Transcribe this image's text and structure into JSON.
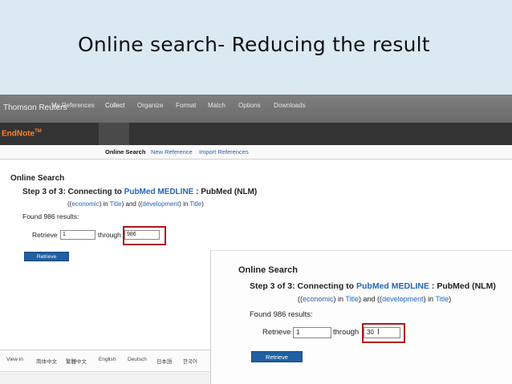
{
  "slide": {
    "title": "Online search- Reducing the result"
  },
  "header": {
    "brand": "Thomson Reuters"
  },
  "nav": {
    "logo": "EndNote",
    "logo_tm": "TM",
    "items": [
      "My References",
      "Collect",
      "Organize",
      "Format",
      "Match",
      "Options",
      "Downloads"
    ],
    "active": "Collect"
  },
  "subnav": {
    "items": [
      "Online Search",
      "New Reference",
      "Import References"
    ],
    "active": "Online Search"
  },
  "panel1": {
    "title": "Online Search",
    "step_prefix": "Step 3 of 3: Connecting to ",
    "step_link": "PubMed MEDLINE",
    "step_suffix": " : PubMed (NLM)",
    "query": {
      "p1": "((",
      "l1": "economic",
      "p2": ") in ",
      "l2": "Title",
      "p3": ") and ((",
      "l3": "development",
      "p4": ") in ",
      "l4": "Title",
      "p5": ")"
    },
    "found": "Found 986 results:",
    "retrieve_label": "Retrieve",
    "from_value": "1",
    "through_label": "through",
    "to_value": "986",
    "retrieve_button": "Retrieve"
  },
  "languages": [
    "View in",
    "简体中文",
    "繁體中文",
    "English",
    "Deutsch",
    "日本語",
    "한국어"
  ],
  "panel2": {
    "title": "Online Search",
    "step_prefix": "Step 3 of 3: Connecting to ",
    "step_link": "PubMed MEDLINE",
    "step_suffix": " : PubMed (NLM)",
    "query": {
      "p1": "((",
      "l1": "economic",
      "p2": ") in ",
      "l2": "Title",
      "p3": ") and ((",
      "l3": "development",
      "p4": ") in ",
      "l4": "Title",
      "p5": ")"
    },
    "found": "Found 986 results:",
    "retrieve_label": "Retrieve",
    "from_value": "1",
    "through_label": "through",
    "to_value": "30",
    "retrieve_button": "Retrieve"
  }
}
